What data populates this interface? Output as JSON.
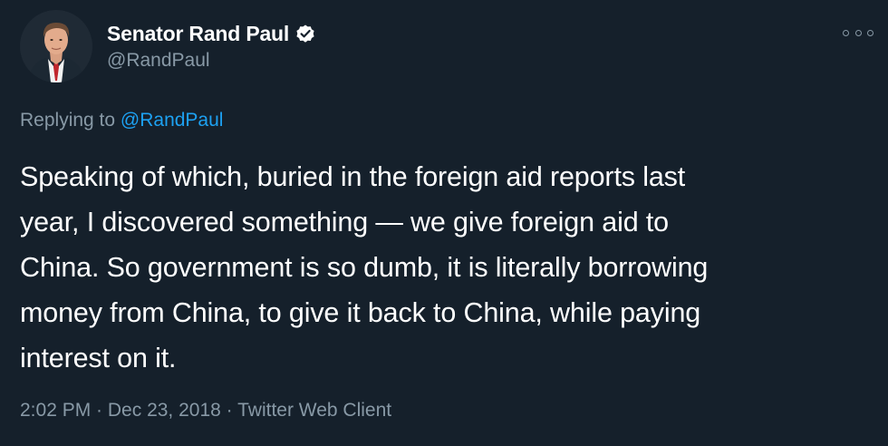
{
  "author": {
    "display_name": "Senator Rand Paul",
    "handle": "@RandPaul",
    "verified": true,
    "verified_icon": "verified-badge-icon"
  },
  "more_icon": "more-options-icon",
  "reply": {
    "prefix": "Replying to",
    "mention": "@RandPaul"
  },
  "tweet": {
    "lines": [
      "Speaking of which, buried in the foreign aid reports last",
      "year, I discovered something — we give foreign aid to",
      "China. So government is so dumb, it is literally borrowing",
      "money from China, to give it back to China, while paying",
      "interest on it."
    ]
  },
  "meta": {
    "time": "2:02 PM",
    "separator": " · ",
    "date": "Dec 23, 2018",
    "source": "Twitter Web Client"
  },
  "colors": {
    "background": "#15202b",
    "text": "#ffffff",
    "secondary": "#8899a6",
    "link": "#1da1f2"
  }
}
